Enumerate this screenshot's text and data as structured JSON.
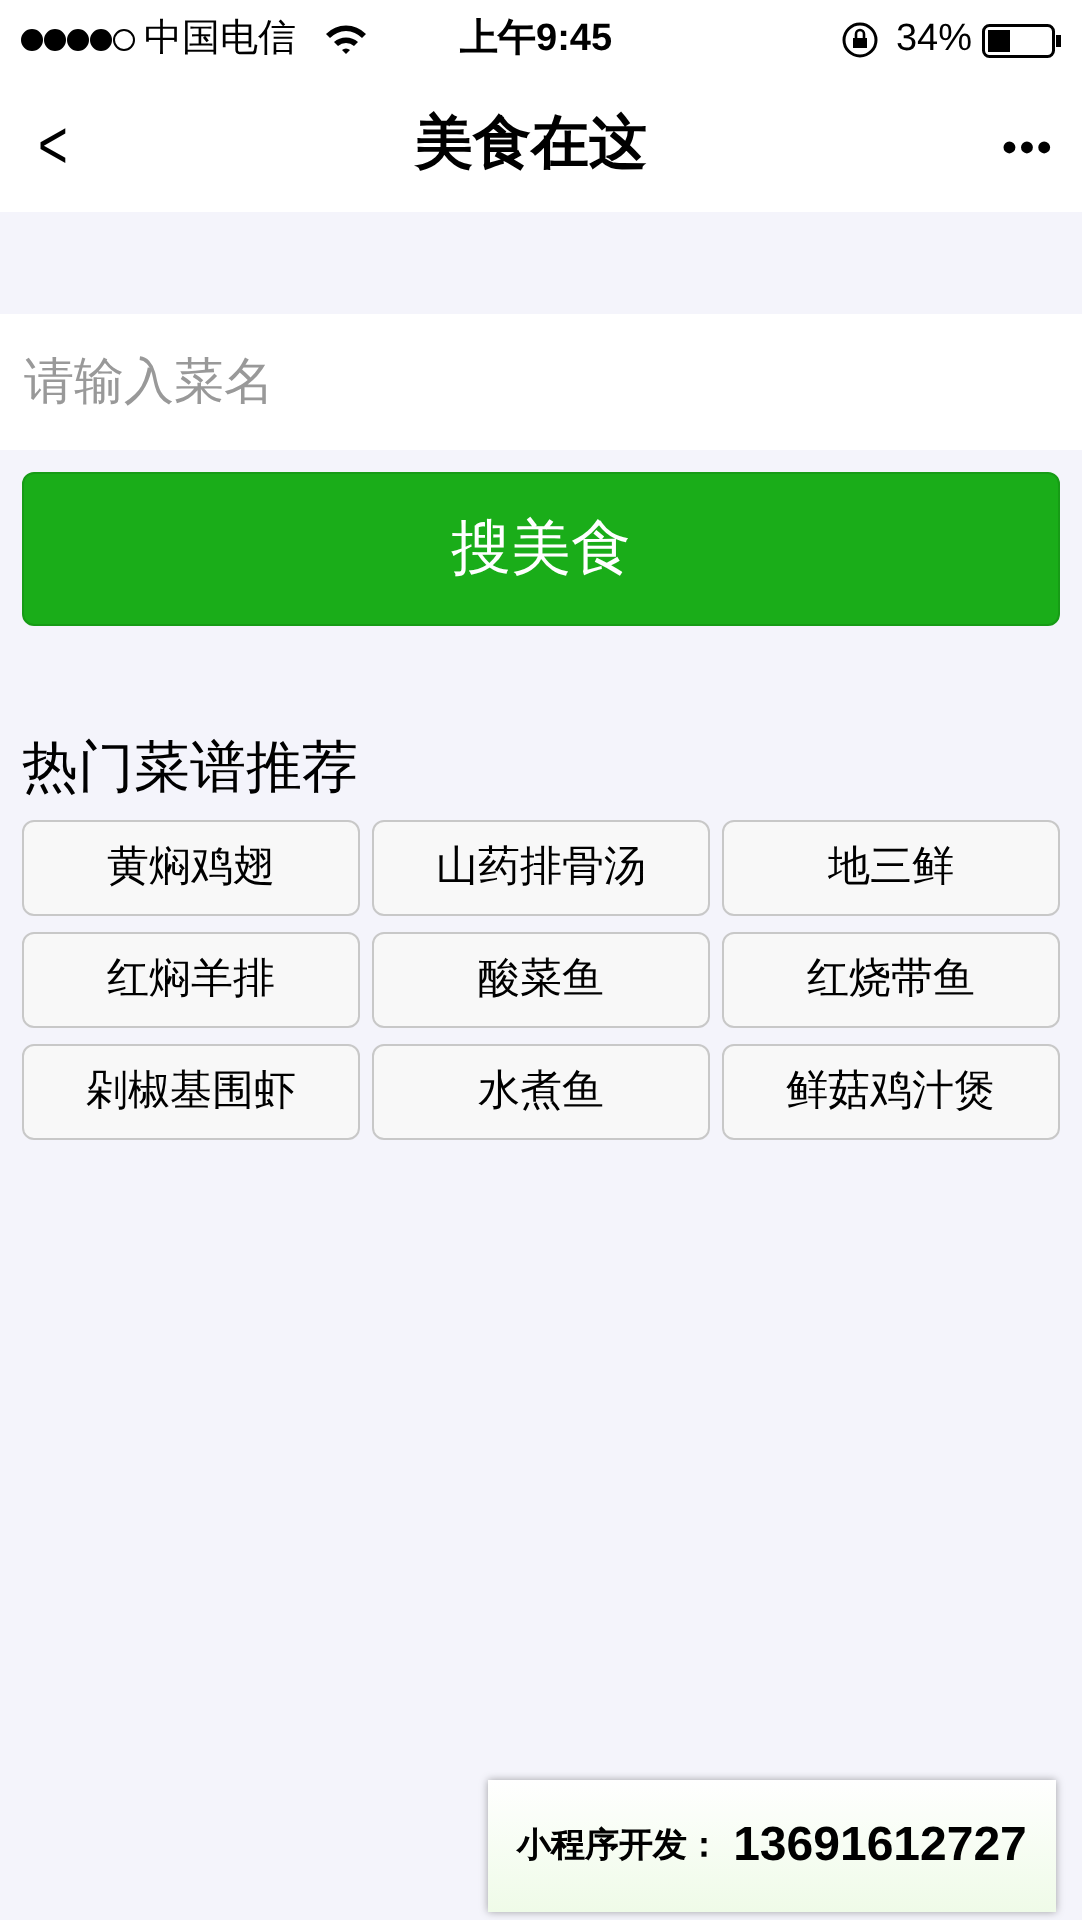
{
  "status_bar": {
    "carrier": "中国电信",
    "time": "上午9:45",
    "battery": "34%"
  },
  "nav": {
    "back": "<",
    "title": "美食在这",
    "more": "•••"
  },
  "search": {
    "placeholder": "请输入菜名",
    "button": "搜美食"
  },
  "section_title": "热门菜谱推荐",
  "dishes": [
    "黄焖鸡翅",
    "山药排骨汤",
    "地三鲜",
    "红焖羊排",
    "酸菜鱼",
    "红烧带鱼",
    "剁椒基围虾",
    "水煮鱼",
    "鲜菇鸡汁煲"
  ],
  "badge": {
    "label": "小程序开发：",
    "phone": "13691612727"
  }
}
